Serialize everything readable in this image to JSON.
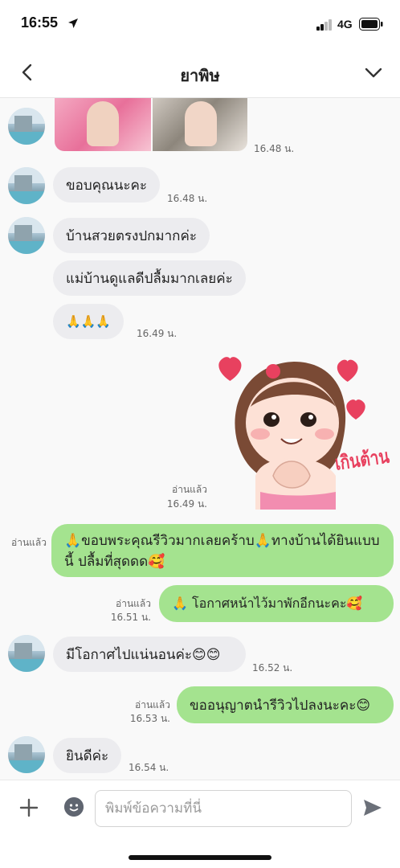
{
  "status_bar": {
    "time": "16:55",
    "network": "4G"
  },
  "header": {
    "title": "ยาพิษ"
  },
  "messages": [
    {
      "id": "m0",
      "time": "16.48 น."
    },
    {
      "id": "m1",
      "text": "ขอบคุณนะคะ",
      "time": "16.48 น."
    },
    {
      "id": "m2",
      "text": "บ้านสวยตรงปกมากค่ะ"
    },
    {
      "id": "m3",
      "text": "แม่บ้านดูแลดีปลื้มมากเลยค่ะ"
    },
    {
      "id": "m4",
      "text": "🙏🙏🙏",
      "time": "16.49 น."
    },
    {
      "id": "m5",
      "read": "อ่านแล้ว",
      "time": "16.49 น.",
      "sticker_text": "เกินต้าน"
    },
    {
      "id": "m6",
      "text": "🙏ขอบพระคุณรีวิวมากเลยคร้าบ🙏ทางบ้านได้ยินแบบนี้ ปลื้มที่สุดดด🥰",
      "read": "อ่านแล้ว"
    },
    {
      "id": "m7",
      "text": "🙏 โอกาศหน้าไว้มาพักอีกนะคะ🥰",
      "read": "อ่านแล้ว",
      "time": "16.51 น."
    },
    {
      "id": "m8",
      "text": "มีโอกาศไปแน่นอนค่ะ😊😊",
      "time": "16.52 น."
    },
    {
      "id": "m9",
      "text": "ขออนุญาตนำรีวิวไปลงนะคะ😊",
      "read": "อ่านแล้ว",
      "time": "16.53 น."
    },
    {
      "id": "m10",
      "text": "ยินดีค่ะ",
      "time": "16.54 น."
    }
  ],
  "composer": {
    "placeholder": "พิมพ์ข้อความที่นี่"
  },
  "colors": {
    "outgoing_bubble": "#a4e38f",
    "incoming_bubble": "#ececef",
    "sticker_heart": "#e8415f"
  }
}
